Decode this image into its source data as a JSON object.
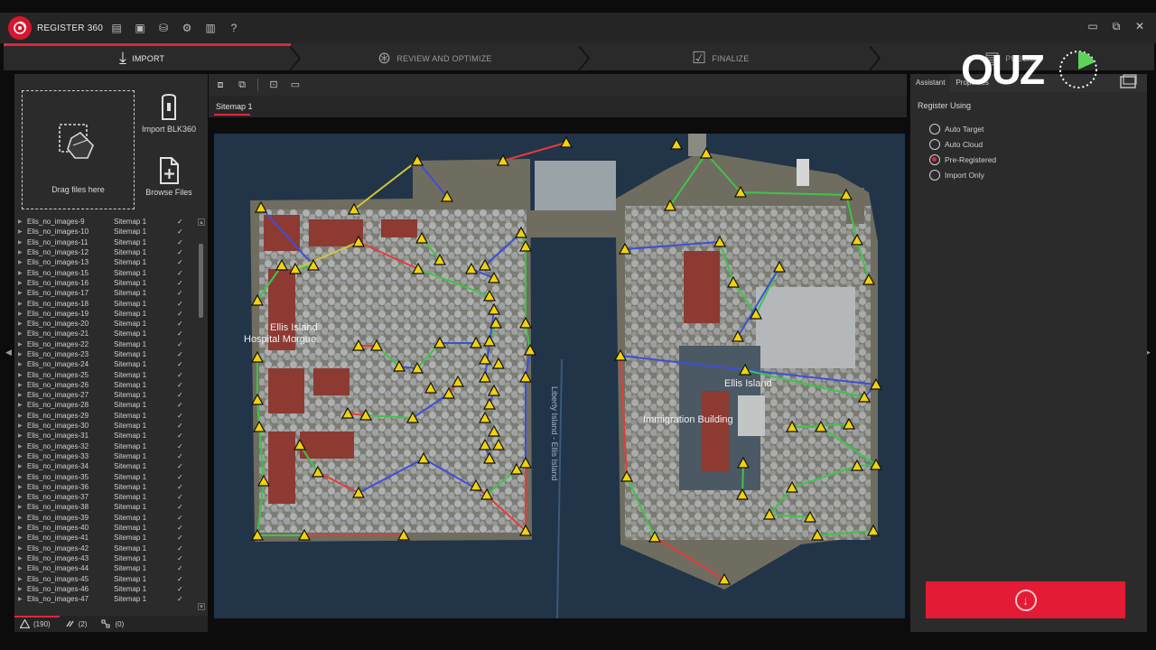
{
  "app": {
    "name": "REGISTER 360"
  },
  "workflow": {
    "steps": [
      {
        "label": "IMPORT"
      },
      {
        "label": "REVIEW AND OPTIMIZE"
      },
      {
        "label": "FINALIZE"
      },
      {
        "label": "PUBLISH"
      }
    ]
  },
  "left": {
    "dropzone_label": "Drag files here",
    "import_blk_label": "Import BLK360",
    "browse_label": "Browse Files",
    "scans": [
      {
        "name": "Elis_no_images-9",
        "sitemap": "Sitemap 1"
      },
      {
        "name": "Elis_no_images-10",
        "sitemap": "Sitemap 1"
      },
      {
        "name": "Elis_no_images-11",
        "sitemap": "Sitemap 1"
      },
      {
        "name": "Elis_no_images-12",
        "sitemap": "Sitemap 1"
      },
      {
        "name": "Elis_no_images-13",
        "sitemap": "Sitemap 1"
      },
      {
        "name": "Elis_no_images-15",
        "sitemap": "Sitemap 1"
      },
      {
        "name": "Elis_no_images-16",
        "sitemap": "Sitemap 1"
      },
      {
        "name": "Elis_no_images-17",
        "sitemap": "Sitemap 1"
      },
      {
        "name": "Elis_no_images-18",
        "sitemap": "Sitemap 1"
      },
      {
        "name": "Elis_no_images-19",
        "sitemap": "Sitemap 1"
      },
      {
        "name": "Elis_no_images-20",
        "sitemap": "Sitemap 1"
      },
      {
        "name": "Elis_no_images-21",
        "sitemap": "Sitemap 1"
      },
      {
        "name": "Elis_no_images-22",
        "sitemap": "Sitemap 1"
      },
      {
        "name": "Elis_no_images-23",
        "sitemap": "Sitemap 1"
      },
      {
        "name": "Elis_no_images-24",
        "sitemap": "Sitemap 1"
      },
      {
        "name": "Elis_no_images-25",
        "sitemap": "Sitemap 1"
      },
      {
        "name": "Elis_no_images-26",
        "sitemap": "Sitemap 1"
      },
      {
        "name": "Elis_no_images-27",
        "sitemap": "Sitemap 1"
      },
      {
        "name": "Elis_no_images-28",
        "sitemap": "Sitemap 1"
      },
      {
        "name": "Elis_no_images-29",
        "sitemap": "Sitemap 1"
      },
      {
        "name": "Elis_no_images-30",
        "sitemap": "Sitemap 1"
      },
      {
        "name": "Elis_no_images-31",
        "sitemap": "Sitemap 1"
      },
      {
        "name": "Elis_no_images-32",
        "sitemap": "Sitemap 1"
      },
      {
        "name": "Elis_no_images-33",
        "sitemap": "Sitemap 1"
      },
      {
        "name": "Elis_no_images-34",
        "sitemap": "Sitemap 1"
      },
      {
        "name": "Elis_no_images-35",
        "sitemap": "Sitemap 1"
      },
      {
        "name": "Elis_no_images-36",
        "sitemap": "Sitemap 1"
      },
      {
        "name": "Elis_no_images-37",
        "sitemap": "Sitemap 1"
      },
      {
        "name": "Elis_no_images-38",
        "sitemap": "Sitemap 1"
      },
      {
        "name": "Elis_no_images-39",
        "sitemap": "Sitemap 1"
      },
      {
        "name": "Elis_no_images-40",
        "sitemap": "Sitemap 1"
      },
      {
        "name": "Elis_no_images-41",
        "sitemap": "Sitemap 1"
      },
      {
        "name": "Elis_no_images-42",
        "sitemap": "Sitemap 1"
      },
      {
        "name": "Elis_no_images-43",
        "sitemap": "Sitemap 1"
      },
      {
        "name": "Elis_no_images-44",
        "sitemap": "Sitemap 1"
      },
      {
        "name": "Elis_no_images-45",
        "sitemap": "Sitemap 1"
      },
      {
        "name": "Elis_no_images-46",
        "sitemap": "Sitemap 1"
      },
      {
        "name": "Elis_no_images-47",
        "sitemap": "Sitemap 1"
      }
    ],
    "check_glyph": "✓",
    "status": {
      "warnings": "(190)",
      "links": "(2)",
      "groups": "(0)"
    }
  },
  "center": {
    "tab_label": "Sitemap 1",
    "map_labels": {
      "island_west": "Ellis Island",
      "hospital": "Hospital Morgue",
      "island_east": "Ellis Island",
      "immigration": "Immigration Building",
      "ferry": "Liberty Island - Ellis Island"
    }
  },
  "right": {
    "tab_assistant": "Assistant",
    "tab_properties": "Properties",
    "section_title": "Register Using",
    "options": [
      {
        "label": "Auto Target",
        "checked": false
      },
      {
        "label": "Auto Cloud",
        "checked": false
      },
      {
        "label": "Pre-Registered",
        "checked": true
      },
      {
        "label": "Import Only",
        "checked": false
      }
    ]
  },
  "watermark": {
    "text": "OUZ"
  },
  "colors": {
    "accent": "#e0263c",
    "link_good": "#3fc34a",
    "link_warn": "#e53b3b",
    "link_manual": "#3c4fd8",
    "link_auto": "#d4c63a",
    "setup_marker": "#f2d20a"
  }
}
